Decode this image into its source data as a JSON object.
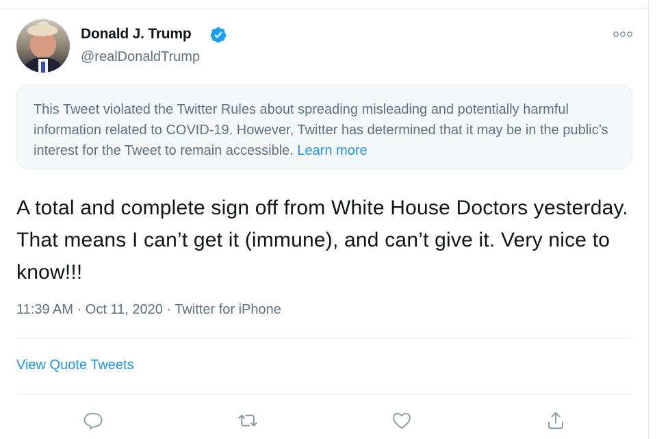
{
  "tweet": {
    "display_name": "Donald J. Trump",
    "handle": "@realDonaldTrump",
    "verified": true,
    "notice": {
      "text": "This Tweet violated the Twitter Rules about spreading misleading and potentially harmful information related to COVID-19. However, Twitter has determined that it may be in the public’s interest for the Tweet to remain accessible.",
      "link_label": "Learn more"
    },
    "text": "A total and complete sign off from White House Doctors yesterday. That means I can’t get it (immune), and can’t give it. Very nice to know!!!",
    "timestamp": "11:39 AM · Oct 11, 2020 · Twitter for iPhone",
    "view_quote_tweets": "View Quote Tweets",
    "icons": {
      "verified": "verified-badge-icon",
      "more": "more-options-icon",
      "reply": "reply-icon",
      "retweet": "retweet-icon",
      "like": "like-icon",
      "share": "share-icon"
    },
    "colors": {
      "accent": "#1b95e0",
      "secondary_text": "#5b7083",
      "icon_gray": "#8899a6"
    }
  }
}
